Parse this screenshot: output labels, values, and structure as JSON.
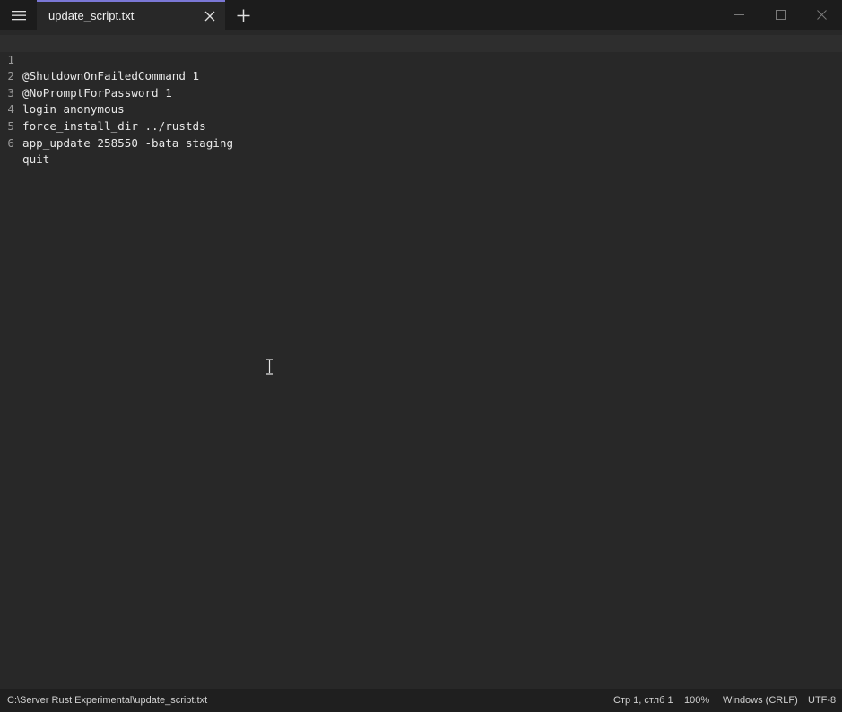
{
  "app": {
    "tab_title": "update_script.txt",
    "accent_color": "#7b78d6"
  },
  "icons": {
    "menu": "hamburger-menu-icon",
    "tab_close": "close-icon",
    "new_tab": "plus-icon",
    "minimize": "minimize-icon",
    "maximize": "maximize-icon",
    "close": "close-icon"
  },
  "editor": {
    "current_line": 1,
    "lines": [
      {
        "num": "1",
        "text": "@ShutdownOnFailedCommand 1"
      },
      {
        "num": "2",
        "text": "@NoPromptForPassword 1"
      },
      {
        "num": "3",
        "text": "login anonymous"
      },
      {
        "num": "4",
        "text": "force_install_dir ../rustds"
      },
      {
        "num": "5",
        "text": "app_update 258550 -bata staging"
      },
      {
        "num": "6",
        "text": "quit"
      }
    ]
  },
  "statusbar": {
    "path": "C:\\Server Rust Experimental\\update_script.txt",
    "position": "Стр 1, стлб 1",
    "zoom": "100%",
    "line_ending": "Windows (CRLF)",
    "encoding": "UTF-8"
  }
}
